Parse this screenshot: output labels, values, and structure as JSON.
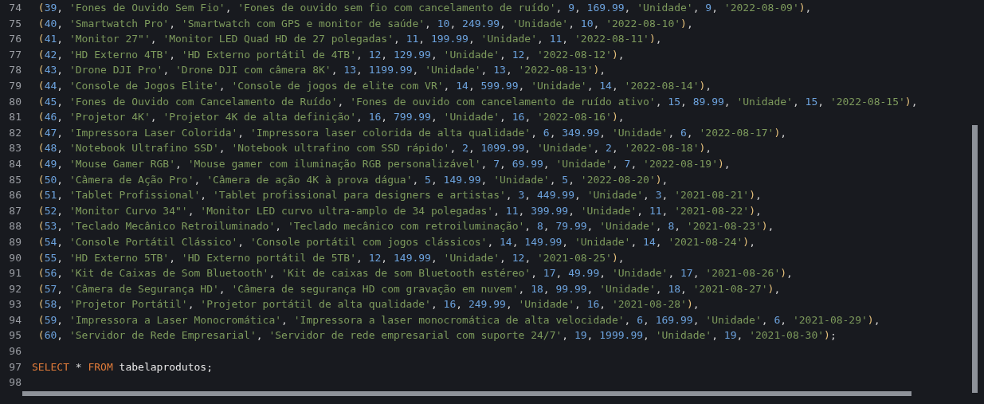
{
  "editor": {
    "lines": [
      {
        "number": "74",
        "tokens": [
          {
            "kind": "paren",
            "text": " ("
          },
          {
            "kind": "number",
            "text": "39"
          },
          {
            "kind": "punct",
            "text": ", "
          },
          {
            "kind": "string",
            "text": "'Fones de Ouvido Sem Fio'"
          },
          {
            "kind": "punct",
            "text": ", "
          },
          {
            "kind": "string",
            "text": "'Fones de ouvido sem fio com cancelamento de ruído'"
          },
          {
            "kind": "punct",
            "text": ", "
          },
          {
            "kind": "number",
            "text": "9"
          },
          {
            "kind": "punct",
            "text": ", "
          },
          {
            "kind": "number",
            "text": "169.99"
          },
          {
            "kind": "punct",
            "text": ", "
          },
          {
            "kind": "string",
            "text": "'Unidade'"
          },
          {
            "kind": "punct",
            "text": ", "
          },
          {
            "kind": "number",
            "text": "9"
          },
          {
            "kind": "punct",
            "text": ", "
          },
          {
            "kind": "string",
            "text": "'2022-08-09'"
          },
          {
            "kind": "paren",
            "text": ")"
          },
          {
            "kind": "punct",
            "text": ","
          }
        ]
      },
      {
        "number": "75",
        "tokens": [
          {
            "kind": "paren",
            "text": " ("
          },
          {
            "kind": "number",
            "text": "40"
          },
          {
            "kind": "punct",
            "text": ", "
          },
          {
            "kind": "string",
            "text": "'Smartwatch Pro'"
          },
          {
            "kind": "punct",
            "text": ", "
          },
          {
            "kind": "string",
            "text": "'Smartwatch com GPS e monitor de saúde'"
          },
          {
            "kind": "punct",
            "text": ", "
          },
          {
            "kind": "number",
            "text": "10"
          },
          {
            "kind": "punct",
            "text": ", "
          },
          {
            "kind": "number",
            "text": "249.99"
          },
          {
            "kind": "punct",
            "text": ", "
          },
          {
            "kind": "string",
            "text": "'Unidade'"
          },
          {
            "kind": "punct",
            "text": ", "
          },
          {
            "kind": "number",
            "text": "10"
          },
          {
            "kind": "punct",
            "text": ", "
          },
          {
            "kind": "string",
            "text": "'2022-08-10'"
          },
          {
            "kind": "paren",
            "text": ")"
          },
          {
            "kind": "punct",
            "text": ","
          }
        ]
      },
      {
        "number": "76",
        "tokens": [
          {
            "kind": "paren",
            "text": " ("
          },
          {
            "kind": "number",
            "text": "41"
          },
          {
            "kind": "punct",
            "text": ", "
          },
          {
            "kind": "string",
            "text": "'Monitor 27\"'"
          },
          {
            "kind": "punct",
            "text": ", "
          },
          {
            "kind": "string",
            "text": "'Monitor LED Quad HD de 27 polegadas'"
          },
          {
            "kind": "punct",
            "text": ", "
          },
          {
            "kind": "number",
            "text": "11"
          },
          {
            "kind": "punct",
            "text": ", "
          },
          {
            "kind": "number",
            "text": "199.99"
          },
          {
            "kind": "punct",
            "text": ", "
          },
          {
            "kind": "string",
            "text": "'Unidade'"
          },
          {
            "kind": "punct",
            "text": ", "
          },
          {
            "kind": "number",
            "text": "11"
          },
          {
            "kind": "punct",
            "text": ", "
          },
          {
            "kind": "string",
            "text": "'2022-08-11'"
          },
          {
            "kind": "paren",
            "text": ")"
          },
          {
            "kind": "punct",
            "text": ","
          }
        ]
      },
      {
        "number": "77",
        "tokens": [
          {
            "kind": "paren",
            "text": " ("
          },
          {
            "kind": "number",
            "text": "42"
          },
          {
            "kind": "punct",
            "text": ", "
          },
          {
            "kind": "string",
            "text": "'HD Externo 4TB'"
          },
          {
            "kind": "punct",
            "text": ", "
          },
          {
            "kind": "string",
            "text": "'HD Externo portátil de 4TB'"
          },
          {
            "kind": "punct",
            "text": ", "
          },
          {
            "kind": "number",
            "text": "12"
          },
          {
            "kind": "punct",
            "text": ", "
          },
          {
            "kind": "number",
            "text": "129.99"
          },
          {
            "kind": "punct",
            "text": ", "
          },
          {
            "kind": "string",
            "text": "'Unidade'"
          },
          {
            "kind": "punct",
            "text": ", "
          },
          {
            "kind": "number",
            "text": "12"
          },
          {
            "kind": "punct",
            "text": ", "
          },
          {
            "kind": "string",
            "text": "'2022-08-12'"
          },
          {
            "kind": "paren",
            "text": ")"
          },
          {
            "kind": "punct",
            "text": ","
          }
        ]
      },
      {
        "number": "78",
        "tokens": [
          {
            "kind": "paren",
            "text": " ("
          },
          {
            "kind": "number",
            "text": "43"
          },
          {
            "kind": "punct",
            "text": ", "
          },
          {
            "kind": "string",
            "text": "'Drone DJI Pro'"
          },
          {
            "kind": "punct",
            "text": ", "
          },
          {
            "kind": "string",
            "text": "'Drone DJI com câmera 8K'"
          },
          {
            "kind": "punct",
            "text": ", "
          },
          {
            "kind": "number",
            "text": "13"
          },
          {
            "kind": "punct",
            "text": ", "
          },
          {
            "kind": "number",
            "text": "1199.99"
          },
          {
            "kind": "punct",
            "text": ", "
          },
          {
            "kind": "string",
            "text": "'Unidade'"
          },
          {
            "kind": "punct",
            "text": ", "
          },
          {
            "kind": "number",
            "text": "13"
          },
          {
            "kind": "punct",
            "text": ", "
          },
          {
            "kind": "string",
            "text": "'2022-08-13'"
          },
          {
            "kind": "paren",
            "text": ")"
          },
          {
            "kind": "punct",
            "text": ","
          }
        ]
      },
      {
        "number": "79",
        "tokens": [
          {
            "kind": "paren",
            "text": " ("
          },
          {
            "kind": "number",
            "text": "44"
          },
          {
            "kind": "punct",
            "text": ", "
          },
          {
            "kind": "string",
            "text": "'Console de Jogos Elite'"
          },
          {
            "kind": "punct",
            "text": ", "
          },
          {
            "kind": "string",
            "text": "'Console de jogos de elite com VR'"
          },
          {
            "kind": "punct",
            "text": ", "
          },
          {
            "kind": "number",
            "text": "14"
          },
          {
            "kind": "punct",
            "text": ", "
          },
          {
            "kind": "number",
            "text": "599.99"
          },
          {
            "kind": "punct",
            "text": ", "
          },
          {
            "kind": "string",
            "text": "'Unidade'"
          },
          {
            "kind": "punct",
            "text": ", "
          },
          {
            "kind": "number",
            "text": "14"
          },
          {
            "kind": "punct",
            "text": ", "
          },
          {
            "kind": "string",
            "text": "'2022-08-14'"
          },
          {
            "kind": "paren",
            "text": ")"
          },
          {
            "kind": "punct",
            "text": ","
          }
        ]
      },
      {
        "number": "80",
        "tokens": [
          {
            "kind": "paren",
            "text": " ("
          },
          {
            "kind": "number",
            "text": "45"
          },
          {
            "kind": "punct",
            "text": ", "
          },
          {
            "kind": "string",
            "text": "'Fones de Ouvido com Cancelamento de Ruído'"
          },
          {
            "kind": "punct",
            "text": ", "
          },
          {
            "kind": "string",
            "text": "'Fones de ouvido com cancelamento de ruído ativo'"
          },
          {
            "kind": "punct",
            "text": ", "
          },
          {
            "kind": "number",
            "text": "15"
          },
          {
            "kind": "punct",
            "text": ", "
          },
          {
            "kind": "number",
            "text": "89.99"
          },
          {
            "kind": "punct",
            "text": ", "
          },
          {
            "kind": "string",
            "text": "'Unidade'"
          },
          {
            "kind": "punct",
            "text": ", "
          },
          {
            "kind": "number",
            "text": "15"
          },
          {
            "kind": "punct",
            "text": ", "
          },
          {
            "kind": "string",
            "text": "'2022-08-15'"
          },
          {
            "kind": "paren",
            "text": ")"
          },
          {
            "kind": "punct",
            "text": ","
          }
        ]
      },
      {
        "number": "81",
        "tokens": [
          {
            "kind": "paren",
            "text": " ("
          },
          {
            "kind": "number",
            "text": "46"
          },
          {
            "kind": "punct",
            "text": ", "
          },
          {
            "kind": "string",
            "text": "'Projetor 4K'"
          },
          {
            "kind": "punct",
            "text": ", "
          },
          {
            "kind": "string",
            "text": "'Projetor 4K de alta definição'"
          },
          {
            "kind": "punct",
            "text": ", "
          },
          {
            "kind": "number",
            "text": "16"
          },
          {
            "kind": "punct",
            "text": ", "
          },
          {
            "kind": "number",
            "text": "799.99"
          },
          {
            "kind": "punct",
            "text": ", "
          },
          {
            "kind": "string",
            "text": "'Unidade'"
          },
          {
            "kind": "punct",
            "text": ", "
          },
          {
            "kind": "number",
            "text": "16"
          },
          {
            "kind": "punct",
            "text": ", "
          },
          {
            "kind": "string",
            "text": "'2022-08-16'"
          },
          {
            "kind": "paren",
            "text": ")"
          },
          {
            "kind": "punct",
            "text": ","
          }
        ]
      },
      {
        "number": "82",
        "tokens": [
          {
            "kind": "paren",
            "text": " ("
          },
          {
            "kind": "number",
            "text": "47"
          },
          {
            "kind": "punct",
            "text": ", "
          },
          {
            "kind": "string",
            "text": "'Impressora Laser Colorida'"
          },
          {
            "kind": "punct",
            "text": ", "
          },
          {
            "kind": "string",
            "text": "'Impressora laser colorida de alta qualidade'"
          },
          {
            "kind": "punct",
            "text": ", "
          },
          {
            "kind": "number",
            "text": "6"
          },
          {
            "kind": "punct",
            "text": ", "
          },
          {
            "kind": "number",
            "text": "349.99"
          },
          {
            "kind": "punct",
            "text": ", "
          },
          {
            "kind": "string",
            "text": "'Unidade'"
          },
          {
            "kind": "punct",
            "text": ", "
          },
          {
            "kind": "number",
            "text": "6"
          },
          {
            "kind": "punct",
            "text": ", "
          },
          {
            "kind": "string",
            "text": "'2022-08-17'"
          },
          {
            "kind": "paren",
            "text": ")"
          },
          {
            "kind": "punct",
            "text": ","
          }
        ]
      },
      {
        "number": "83",
        "tokens": [
          {
            "kind": "paren",
            "text": " ("
          },
          {
            "kind": "number",
            "text": "48"
          },
          {
            "kind": "punct",
            "text": ", "
          },
          {
            "kind": "string",
            "text": "'Notebook Ultrafino SSD'"
          },
          {
            "kind": "punct",
            "text": ", "
          },
          {
            "kind": "string",
            "text": "'Notebook ultrafino com SSD rápido'"
          },
          {
            "kind": "punct",
            "text": ", "
          },
          {
            "kind": "number",
            "text": "2"
          },
          {
            "kind": "punct",
            "text": ", "
          },
          {
            "kind": "number",
            "text": "1099.99"
          },
          {
            "kind": "punct",
            "text": ", "
          },
          {
            "kind": "string",
            "text": "'Unidade'"
          },
          {
            "kind": "punct",
            "text": ", "
          },
          {
            "kind": "number",
            "text": "2"
          },
          {
            "kind": "punct",
            "text": ", "
          },
          {
            "kind": "string",
            "text": "'2022-08-18'"
          },
          {
            "kind": "paren",
            "text": ")"
          },
          {
            "kind": "punct",
            "text": ","
          }
        ]
      },
      {
        "number": "84",
        "tokens": [
          {
            "kind": "paren",
            "text": " ("
          },
          {
            "kind": "number",
            "text": "49"
          },
          {
            "kind": "punct",
            "text": ", "
          },
          {
            "kind": "string",
            "text": "'Mouse Gamer RGB'"
          },
          {
            "kind": "punct",
            "text": ", "
          },
          {
            "kind": "string",
            "text": "'Mouse gamer com iluminação RGB personalizável'"
          },
          {
            "kind": "punct",
            "text": ", "
          },
          {
            "kind": "number",
            "text": "7"
          },
          {
            "kind": "punct",
            "text": ", "
          },
          {
            "kind": "number",
            "text": "69.99"
          },
          {
            "kind": "punct",
            "text": ", "
          },
          {
            "kind": "string",
            "text": "'Unidade'"
          },
          {
            "kind": "punct",
            "text": ", "
          },
          {
            "kind": "number",
            "text": "7"
          },
          {
            "kind": "punct",
            "text": ", "
          },
          {
            "kind": "string",
            "text": "'2022-08-19'"
          },
          {
            "kind": "paren",
            "text": ")"
          },
          {
            "kind": "punct",
            "text": ","
          }
        ]
      },
      {
        "number": "85",
        "tokens": [
          {
            "kind": "paren",
            "text": " ("
          },
          {
            "kind": "number",
            "text": "50"
          },
          {
            "kind": "punct",
            "text": ", "
          },
          {
            "kind": "string",
            "text": "'Câmera de Ação Pro'"
          },
          {
            "kind": "punct",
            "text": ", "
          },
          {
            "kind": "string",
            "text": "'Câmera de ação 4K à prova dágua'"
          },
          {
            "kind": "punct",
            "text": ", "
          },
          {
            "kind": "number",
            "text": "5"
          },
          {
            "kind": "punct",
            "text": ", "
          },
          {
            "kind": "number",
            "text": "149.99"
          },
          {
            "kind": "punct",
            "text": ", "
          },
          {
            "kind": "string",
            "text": "'Unidade'"
          },
          {
            "kind": "punct",
            "text": ", "
          },
          {
            "kind": "number",
            "text": "5"
          },
          {
            "kind": "punct",
            "text": ", "
          },
          {
            "kind": "string",
            "text": "'2022-08-20'"
          },
          {
            "kind": "paren",
            "text": ")"
          },
          {
            "kind": "punct",
            "text": ","
          }
        ]
      },
      {
        "number": "86",
        "tokens": [
          {
            "kind": "paren",
            "text": " ("
          },
          {
            "kind": "number",
            "text": "51"
          },
          {
            "kind": "punct",
            "text": ", "
          },
          {
            "kind": "string",
            "text": "'Tablet Profissional'"
          },
          {
            "kind": "punct",
            "text": ", "
          },
          {
            "kind": "string",
            "text": "'Tablet profissional para designers e artistas'"
          },
          {
            "kind": "punct",
            "text": ", "
          },
          {
            "kind": "number",
            "text": "3"
          },
          {
            "kind": "punct",
            "text": ", "
          },
          {
            "kind": "number",
            "text": "449.99"
          },
          {
            "kind": "punct",
            "text": ", "
          },
          {
            "kind": "string",
            "text": "'Unidade'"
          },
          {
            "kind": "punct",
            "text": ", "
          },
          {
            "kind": "number",
            "text": "3"
          },
          {
            "kind": "punct",
            "text": ", "
          },
          {
            "kind": "string",
            "text": "'2021-08-21'"
          },
          {
            "kind": "paren",
            "text": ")"
          },
          {
            "kind": "punct",
            "text": ","
          }
        ]
      },
      {
        "number": "87",
        "tokens": [
          {
            "kind": "paren",
            "text": " ("
          },
          {
            "kind": "number",
            "text": "52"
          },
          {
            "kind": "punct",
            "text": ", "
          },
          {
            "kind": "string",
            "text": "'Monitor Curvo 34\"'"
          },
          {
            "kind": "punct",
            "text": ", "
          },
          {
            "kind": "string",
            "text": "'Monitor LED curvo ultra-amplo de 34 polegadas'"
          },
          {
            "kind": "punct",
            "text": ", "
          },
          {
            "kind": "number",
            "text": "11"
          },
          {
            "kind": "punct",
            "text": ", "
          },
          {
            "kind": "number",
            "text": "399.99"
          },
          {
            "kind": "punct",
            "text": ", "
          },
          {
            "kind": "string",
            "text": "'Unidade'"
          },
          {
            "kind": "punct",
            "text": ", "
          },
          {
            "kind": "number",
            "text": "11"
          },
          {
            "kind": "punct",
            "text": ", "
          },
          {
            "kind": "string",
            "text": "'2021-08-22'"
          },
          {
            "kind": "paren",
            "text": ")"
          },
          {
            "kind": "punct",
            "text": ","
          }
        ]
      },
      {
        "number": "88",
        "tokens": [
          {
            "kind": "paren",
            "text": " ("
          },
          {
            "kind": "number",
            "text": "53"
          },
          {
            "kind": "punct",
            "text": ", "
          },
          {
            "kind": "string",
            "text": "'Teclado Mecânico Retroiluminado'"
          },
          {
            "kind": "punct",
            "text": ", "
          },
          {
            "kind": "string",
            "text": "'Teclado mecânico com retroiluminação'"
          },
          {
            "kind": "punct",
            "text": ", "
          },
          {
            "kind": "number",
            "text": "8"
          },
          {
            "kind": "punct",
            "text": ", "
          },
          {
            "kind": "number",
            "text": "79.99"
          },
          {
            "kind": "punct",
            "text": ", "
          },
          {
            "kind": "string",
            "text": "'Unidade'"
          },
          {
            "kind": "punct",
            "text": ", "
          },
          {
            "kind": "number",
            "text": "8"
          },
          {
            "kind": "punct",
            "text": ", "
          },
          {
            "kind": "string",
            "text": "'2021-08-23'"
          },
          {
            "kind": "paren",
            "text": ")"
          },
          {
            "kind": "punct",
            "text": ","
          }
        ]
      },
      {
        "number": "89",
        "tokens": [
          {
            "kind": "paren",
            "text": " ("
          },
          {
            "kind": "number",
            "text": "54"
          },
          {
            "kind": "punct",
            "text": ", "
          },
          {
            "kind": "string",
            "text": "'Console Portátil Clássico'"
          },
          {
            "kind": "punct",
            "text": ", "
          },
          {
            "kind": "string",
            "text": "'Console portátil com jogos clássicos'"
          },
          {
            "kind": "punct",
            "text": ", "
          },
          {
            "kind": "number",
            "text": "14"
          },
          {
            "kind": "punct",
            "text": ", "
          },
          {
            "kind": "number",
            "text": "149.99"
          },
          {
            "kind": "punct",
            "text": ", "
          },
          {
            "kind": "string",
            "text": "'Unidade'"
          },
          {
            "kind": "punct",
            "text": ", "
          },
          {
            "kind": "number",
            "text": "14"
          },
          {
            "kind": "punct",
            "text": ", "
          },
          {
            "kind": "string",
            "text": "'2021-08-24'"
          },
          {
            "kind": "paren",
            "text": ")"
          },
          {
            "kind": "punct",
            "text": ","
          }
        ]
      },
      {
        "number": "90",
        "tokens": [
          {
            "kind": "paren",
            "text": " ("
          },
          {
            "kind": "number",
            "text": "55"
          },
          {
            "kind": "punct",
            "text": ", "
          },
          {
            "kind": "string",
            "text": "'HD Externo 5TB'"
          },
          {
            "kind": "punct",
            "text": ", "
          },
          {
            "kind": "string",
            "text": "'HD Externo portátil de 5TB'"
          },
          {
            "kind": "punct",
            "text": ", "
          },
          {
            "kind": "number",
            "text": "12"
          },
          {
            "kind": "punct",
            "text": ", "
          },
          {
            "kind": "number",
            "text": "149.99"
          },
          {
            "kind": "punct",
            "text": ", "
          },
          {
            "kind": "string",
            "text": "'Unidade'"
          },
          {
            "kind": "punct",
            "text": ", "
          },
          {
            "kind": "number",
            "text": "12"
          },
          {
            "kind": "punct",
            "text": ", "
          },
          {
            "kind": "string",
            "text": "'2021-08-25'"
          },
          {
            "kind": "paren",
            "text": ")"
          },
          {
            "kind": "punct",
            "text": ","
          }
        ]
      },
      {
        "number": "91",
        "tokens": [
          {
            "kind": "paren",
            "text": " ("
          },
          {
            "kind": "number",
            "text": "56"
          },
          {
            "kind": "punct",
            "text": ", "
          },
          {
            "kind": "string",
            "text": "'Kit de Caixas de Som Bluetooth'"
          },
          {
            "kind": "punct",
            "text": ", "
          },
          {
            "kind": "string",
            "text": "'Kit de caixas de som Bluetooth estéreo'"
          },
          {
            "kind": "punct",
            "text": ", "
          },
          {
            "kind": "number",
            "text": "17"
          },
          {
            "kind": "punct",
            "text": ", "
          },
          {
            "kind": "number",
            "text": "49.99"
          },
          {
            "kind": "punct",
            "text": ", "
          },
          {
            "kind": "string",
            "text": "'Unidade'"
          },
          {
            "kind": "punct",
            "text": ", "
          },
          {
            "kind": "number",
            "text": "17"
          },
          {
            "kind": "punct",
            "text": ", "
          },
          {
            "kind": "string",
            "text": "'2021-08-26'"
          },
          {
            "kind": "paren",
            "text": ")"
          },
          {
            "kind": "punct",
            "text": ","
          }
        ]
      },
      {
        "number": "92",
        "tokens": [
          {
            "kind": "paren",
            "text": " ("
          },
          {
            "kind": "number",
            "text": "57"
          },
          {
            "kind": "punct",
            "text": ", "
          },
          {
            "kind": "string",
            "text": "'Câmera de Segurança HD'"
          },
          {
            "kind": "punct",
            "text": ", "
          },
          {
            "kind": "string",
            "text": "'Câmera de segurança HD com gravação em nuvem'"
          },
          {
            "kind": "punct",
            "text": ", "
          },
          {
            "kind": "number",
            "text": "18"
          },
          {
            "kind": "punct",
            "text": ", "
          },
          {
            "kind": "number",
            "text": "99.99"
          },
          {
            "kind": "punct",
            "text": ", "
          },
          {
            "kind": "string",
            "text": "'Unidade'"
          },
          {
            "kind": "punct",
            "text": ", "
          },
          {
            "kind": "number",
            "text": "18"
          },
          {
            "kind": "punct",
            "text": ", "
          },
          {
            "kind": "string",
            "text": "'2021-08-27'"
          },
          {
            "kind": "paren",
            "text": ")"
          },
          {
            "kind": "punct",
            "text": ","
          }
        ]
      },
      {
        "number": "93",
        "tokens": [
          {
            "kind": "paren",
            "text": " ("
          },
          {
            "kind": "number",
            "text": "58"
          },
          {
            "kind": "punct",
            "text": ", "
          },
          {
            "kind": "string",
            "text": "'Projetor Portátil'"
          },
          {
            "kind": "punct",
            "text": ", "
          },
          {
            "kind": "string",
            "text": "'Projetor portátil de alta qualidade'"
          },
          {
            "kind": "punct",
            "text": ", "
          },
          {
            "kind": "number",
            "text": "16"
          },
          {
            "kind": "punct",
            "text": ", "
          },
          {
            "kind": "number",
            "text": "249.99"
          },
          {
            "kind": "punct",
            "text": ", "
          },
          {
            "kind": "string",
            "text": "'Unidade'"
          },
          {
            "kind": "punct",
            "text": ", "
          },
          {
            "kind": "number",
            "text": "16"
          },
          {
            "kind": "punct",
            "text": ", "
          },
          {
            "kind": "string",
            "text": "'2021-08-28'"
          },
          {
            "kind": "paren",
            "text": ")"
          },
          {
            "kind": "punct",
            "text": ","
          }
        ]
      },
      {
        "number": "94",
        "tokens": [
          {
            "kind": "paren",
            "text": " ("
          },
          {
            "kind": "number",
            "text": "59"
          },
          {
            "kind": "punct",
            "text": ", "
          },
          {
            "kind": "string",
            "text": "'Impressora a Laser Monocromática'"
          },
          {
            "kind": "punct",
            "text": ", "
          },
          {
            "kind": "string",
            "text": "'Impressora a laser monocromática de alta velocidade'"
          },
          {
            "kind": "punct",
            "text": ", "
          },
          {
            "kind": "number",
            "text": "6"
          },
          {
            "kind": "punct",
            "text": ", "
          },
          {
            "kind": "number",
            "text": "169.99"
          },
          {
            "kind": "punct",
            "text": ", "
          },
          {
            "kind": "string",
            "text": "'Unidade'"
          },
          {
            "kind": "punct",
            "text": ", "
          },
          {
            "kind": "number",
            "text": "6"
          },
          {
            "kind": "punct",
            "text": ", "
          },
          {
            "kind": "string",
            "text": "'2021-08-29'"
          },
          {
            "kind": "paren",
            "text": ")"
          },
          {
            "kind": "punct",
            "text": ","
          }
        ]
      },
      {
        "number": "95",
        "tokens": [
          {
            "kind": "paren",
            "text": " ("
          },
          {
            "kind": "number",
            "text": "60"
          },
          {
            "kind": "punct",
            "text": ", "
          },
          {
            "kind": "string",
            "text": "'Servidor de Rede Empresarial'"
          },
          {
            "kind": "punct",
            "text": ", "
          },
          {
            "kind": "string",
            "text": "'Servidor de rede empresarial com suporte 24/7'"
          },
          {
            "kind": "punct",
            "text": ", "
          },
          {
            "kind": "number",
            "text": "19"
          },
          {
            "kind": "punct",
            "text": ", "
          },
          {
            "kind": "number",
            "text": "1999.99"
          },
          {
            "kind": "punct",
            "text": ", "
          },
          {
            "kind": "string",
            "text": "'Unidade'"
          },
          {
            "kind": "punct",
            "text": ", "
          },
          {
            "kind": "number",
            "text": "19"
          },
          {
            "kind": "punct",
            "text": ", "
          },
          {
            "kind": "string",
            "text": "'2021-08-30'"
          },
          {
            "kind": "paren",
            "text": ")"
          },
          {
            "kind": "punct",
            "text": ";"
          }
        ]
      },
      {
        "number": "96"
      },
      {
        "number": "97",
        "tokens": [
          {
            "kind": "keyword",
            "text": "SELECT"
          },
          {
            "kind": "punct",
            "text": " * "
          },
          {
            "kind": "keyword",
            "text": "FROM"
          },
          {
            "kind": "plain",
            "text": " tabelaprodutos;"
          }
        ]
      },
      {
        "number": "98"
      }
    ]
  }
}
